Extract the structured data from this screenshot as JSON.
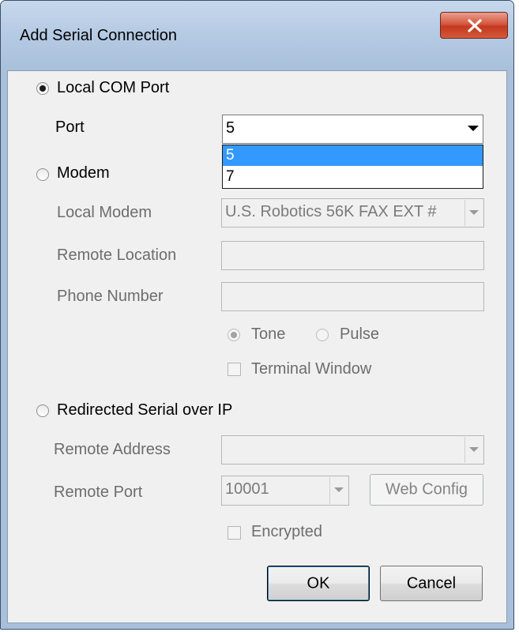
{
  "window": {
    "title": "Add Serial Connection",
    "close_label": "X"
  },
  "local_com": {
    "option_label": "Local COM Port",
    "selected": true,
    "port_label": "Port",
    "port_value": "5",
    "port_dropdown_open": true,
    "port_options": [
      "5",
      "7"
    ],
    "port_highlighted": "5"
  },
  "modem": {
    "option_label": "Modem",
    "selected": false,
    "local_modem_label": "Local Modem",
    "local_modem_value": "U.S. Robotics 56K FAX EXT #",
    "remote_location_label": "Remote Location",
    "remote_location_value": "",
    "phone_number_label": "Phone Number",
    "phone_number_value": "",
    "tone_label": "Tone",
    "tone_selected": true,
    "pulse_label": "Pulse",
    "pulse_selected": false,
    "terminal_window_label": "Terminal Window",
    "terminal_window_checked": false
  },
  "redirected": {
    "option_label": "Redirected Serial over IP",
    "selected": false,
    "remote_address_label": "Remote Address",
    "remote_address_value": "",
    "remote_port_label": "Remote Port",
    "remote_port_value": "10001",
    "web_config_label": "Web Config",
    "encrypted_label": "Encrypted",
    "encrypted_checked": false
  },
  "buttons": {
    "ok_label": "OK",
    "cancel_label": "Cancel"
  }
}
